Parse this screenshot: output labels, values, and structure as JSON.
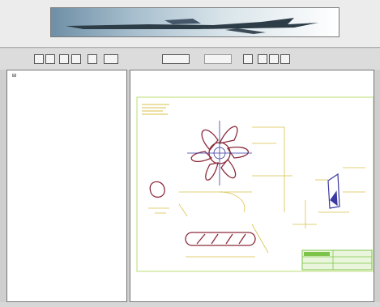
{
  "banner": {
    "icon": "aircraft-banner-image"
  },
  "toolbar": {
    "left_buttons": [
      "",
      "",
      "",
      "",
      ""
    ],
    "center_buttons": [
      {
        "label": "",
        "enabled": true
      },
      {
        "label": "",
        "enabled": false
      }
    ],
    "right_buttons": [
      "",
      "",
      "",
      ""
    ]
  },
  "tree": {
    "root_label": "",
    "child_label": ""
  },
  "viewer": {
    "border_color": "#c6e28a",
    "shape_colors": {
      "outline": "#8c2b3b",
      "dimension": "#d8c24a",
      "center": "#3a3aa0",
      "titleblock": "#7fc44a"
    },
    "title_block_lines": [
      "",
      "",
      ""
    ]
  }
}
